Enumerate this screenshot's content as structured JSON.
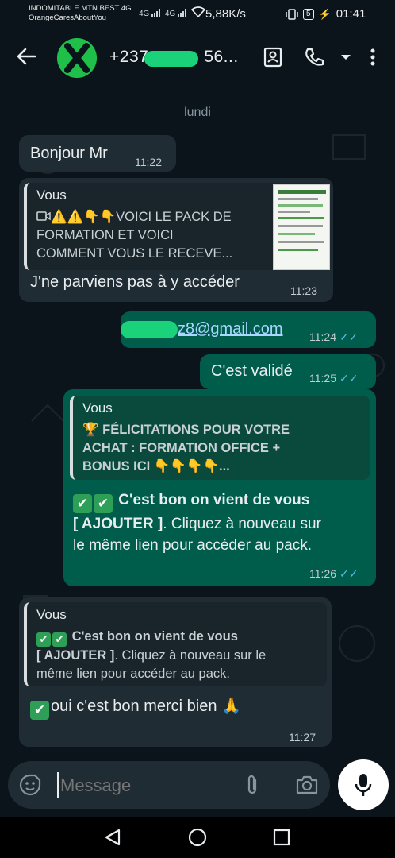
{
  "status_bar": {
    "carrier_line1": "INDOMITABLE MTN BEST 4G",
    "carrier_line2": "OrangeCaresAboutYou",
    "signal_label_a": "4G",
    "signal_label_b": "4G",
    "net_speed": "5,88K/s",
    "battery_level": "5",
    "clock": "01:41"
  },
  "header": {
    "contact_prefix": "+237",
    "contact_suffix": "56...",
    "icons": [
      "back-arrow-icon",
      "contact-card-icon",
      "phone-icon",
      "chevron-down-icon",
      "more-vert-icon"
    ]
  },
  "chat": {
    "date_label": "lundi",
    "messages": [
      {
        "text": "Bonjour Mr",
        "time": "11:22"
      },
      {
        "quote_author": "Vous",
        "quote_line1": "⚠️⚠️👇👇VOICI LE PACK DE",
        "quote_line2": "FORMATION ET VOICI",
        "quote_line3": "COMMENT VOUS LE RECEVE...",
        "text": "J'ne parviens pas à y accéder",
        "time": "11:23"
      },
      {
        "text": "z8@gmail.com",
        "time": "11:24"
      },
      {
        "text": "C'est validé",
        "time": "11:25"
      },
      {
        "quote_author": "Vous",
        "quote_line1": "🏆 FÉLICITATIONS POUR VOTRE",
        "quote_line2": "ACHAT : FORMATION OFFICE +",
        "quote_line3": "BONUS ICI 👇👇👇👇...",
        "text_bold": "C'est bon on vient de vous",
        "text_bold2": "[ AJOUTER ]",
        "text_rest": ". Cliquez à nouveau sur",
        "text_line3": "le même lien pour accéder au pack.",
        "time": "11:26"
      },
      {
        "quote_author": "Vous",
        "quote_line1_bold": "C'est bon on vient de vous",
        "quote_line2_bold": "[ AJOUTER ]",
        "quote_line2_rest": ". Cliquez à nouveau sur le",
        "quote_line3": "même lien pour accéder au pack.",
        "text": "oui c'est bon merci bien 🙏",
        "time": "11:27"
      }
    ]
  },
  "composer": {
    "placeholder": "Message"
  },
  "colors": {
    "background": "#0b141a",
    "incoming_bubble": "#202c33",
    "outgoing_bubble": "#005c4b",
    "read_ticks": "#53bdeb",
    "avatar_green": "#1fc04a"
  }
}
